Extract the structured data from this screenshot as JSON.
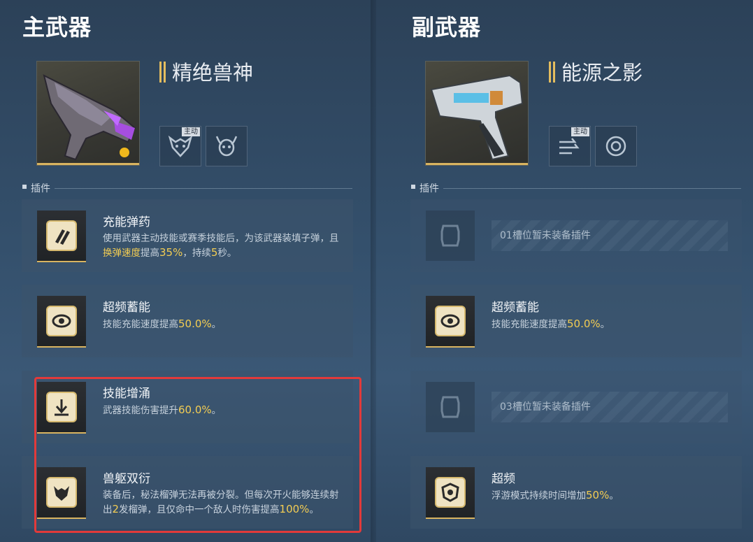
{
  "primary": {
    "title": "主武器",
    "weapon_name": "精绝兽神",
    "skill_tag": "主动",
    "section_label": "插件",
    "cards": [
      {
        "title": "充能弹药",
        "desc_parts": [
          "使用武器主动技能或赛季技能后，为该武器装填子弹，且",
          "换弹速度",
          "提高",
          "35%",
          "，持续",
          "5",
          "秒。"
        ]
      },
      {
        "title": "超频蓄能",
        "desc_parts": [
          "技能充能速度提高",
          "50.0%",
          "。"
        ]
      },
      {
        "title": "技能增涌",
        "desc_parts": [
          "武器技能伤害提升",
          "60.0%",
          "。"
        ]
      },
      {
        "title": "兽躯双衍",
        "desc_parts": [
          "装备后，秘法榴弹无法再被分裂。但每次开火能够连续射出",
          "2",
          "发榴弹，且仅命中一个敌人时伤害提高",
          "100%",
          "。"
        ]
      }
    ]
  },
  "secondary": {
    "title": "副武器",
    "weapon_name": "能源之影",
    "skill_tag": "主动",
    "section_label": "插件",
    "cards": [
      {
        "empty": true,
        "text": "01槽位暂未装备插件"
      },
      {
        "title": "超频蓄能",
        "desc_parts": [
          "技能充能速度提高",
          "50.0%",
          "。"
        ]
      },
      {
        "empty": true,
        "text": "03槽位暂未装备插件"
      },
      {
        "title": "超频",
        "desc_parts": [
          "浮游模式持续时间增加",
          "50%",
          "。"
        ]
      }
    ]
  },
  "colors": {
    "accent_gold": "#d9b460",
    "highlight_yellow": "#f3cd53",
    "annotation_red": "#e23a3a"
  },
  "icons": {
    "primary_skills": [
      "beast-mask-icon",
      "horned-skull-icon"
    ],
    "secondary_skills": [
      "dash-arrows-icon",
      "vortex-icon"
    ],
    "primary_plugins": [
      "bullets-icon",
      "eye-icon",
      "surge-arrow-icon",
      "beast-head-icon"
    ],
    "secondary_plugins": [
      "empty-slot-icon",
      "eye-icon",
      "empty-slot-icon",
      "shield-eye-icon"
    ]
  }
}
